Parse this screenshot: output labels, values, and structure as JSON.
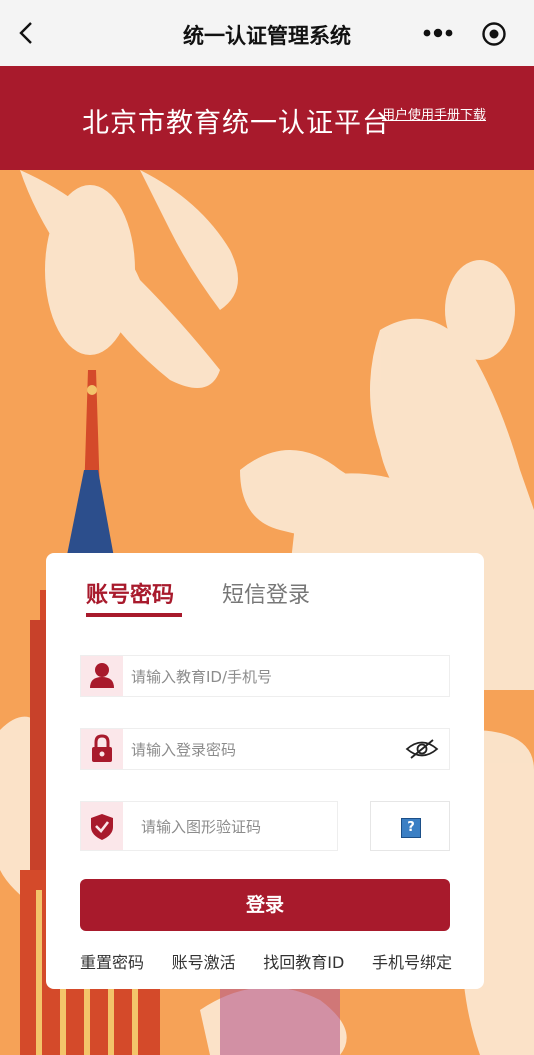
{
  "nav": {
    "title": "统一认证管理系统"
  },
  "banner": {
    "title": "北京市教育统一认证平台",
    "manual_link": "用户使用手册下载"
  },
  "login": {
    "tabs": [
      "账号密码",
      "短信登录"
    ],
    "id_placeholder": "请输入教育ID/手机号",
    "password_placeholder": "请输入登录密码",
    "captcha_placeholder": "请输入图形验证码",
    "captcha_image_text": "?",
    "submit": "登录",
    "links": [
      "重置密码",
      "账号激活",
      "找回教育ID",
      "手机号绑定"
    ]
  },
  "colors": {
    "brand": "#a81a2c",
    "background": "#f6a257",
    "icon_bg": "#fbe7ea"
  },
  "icons": [
    "back-icon",
    "more-icon",
    "target-icon",
    "user-icon",
    "lock-icon",
    "eye-icon",
    "shield-icon"
  ]
}
